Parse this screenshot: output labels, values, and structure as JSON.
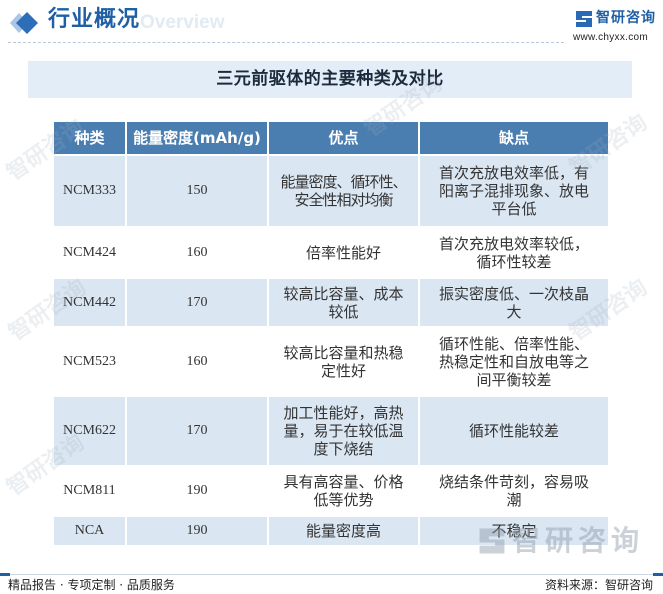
{
  "colors": {
    "accent": "#1f5fa6",
    "table_header_bg": "#4b7eb0",
    "row_highlight_bg": "#dae6f2",
    "banner_bg": "#e3edf7"
  },
  "header": {
    "icon": "diamond-icon",
    "title": "行业概况",
    "subtitle": "Overview"
  },
  "brand": {
    "icon": "logo-icon",
    "name": "智研咨询",
    "url": "www.chyxx.com"
  },
  "banner": {
    "title": "三元前驱体的主要种类及对比"
  },
  "table": {
    "columns": [
      "种类",
      "能量密度(mAh/g)",
      "优点",
      "缺点"
    ],
    "rows": [
      {
        "type": "NCM333",
        "energy_density": 150,
        "pros": "能量密度、循环性、安全性相对均衡",
        "cons": "首次充放电效率低，有阳离子混排现象、放电平台低"
      },
      {
        "type": "NCM424",
        "energy_density": 160,
        "pros": "倍率性能好",
        "cons": "首次充放电效率较低，循环性较差"
      },
      {
        "type": "NCM442",
        "energy_density": 170,
        "pros": "较高比容量、成本较低",
        "cons": "振实密度低、一次枝晶大"
      },
      {
        "type": "NCM523",
        "energy_density": 160,
        "pros": "较高比容量和热稳定性好",
        "cons": "循环性能、倍率性能、热稳定性和自放电等之间平衡较差"
      },
      {
        "type": "NCM622",
        "energy_density": 170,
        "pros": "加工性能好，高热量，易于在较低温度下烧结",
        "cons": "循环性能较差"
      },
      {
        "type": "NCM811",
        "energy_density": 190,
        "pros": "具有高容量、价格低等优势",
        "cons": "烧结条件苛刻，容易吸潮"
      },
      {
        "type": "NCA",
        "energy_density": 190,
        "pros": "能量密度高",
        "cons": "不稳定"
      }
    ]
  },
  "watermark": {
    "text": "智研咨询"
  },
  "footer": {
    "slogan": "精品报告 · 专项定制 · 品质服务",
    "source": "资料来源：智研咨询"
  }
}
